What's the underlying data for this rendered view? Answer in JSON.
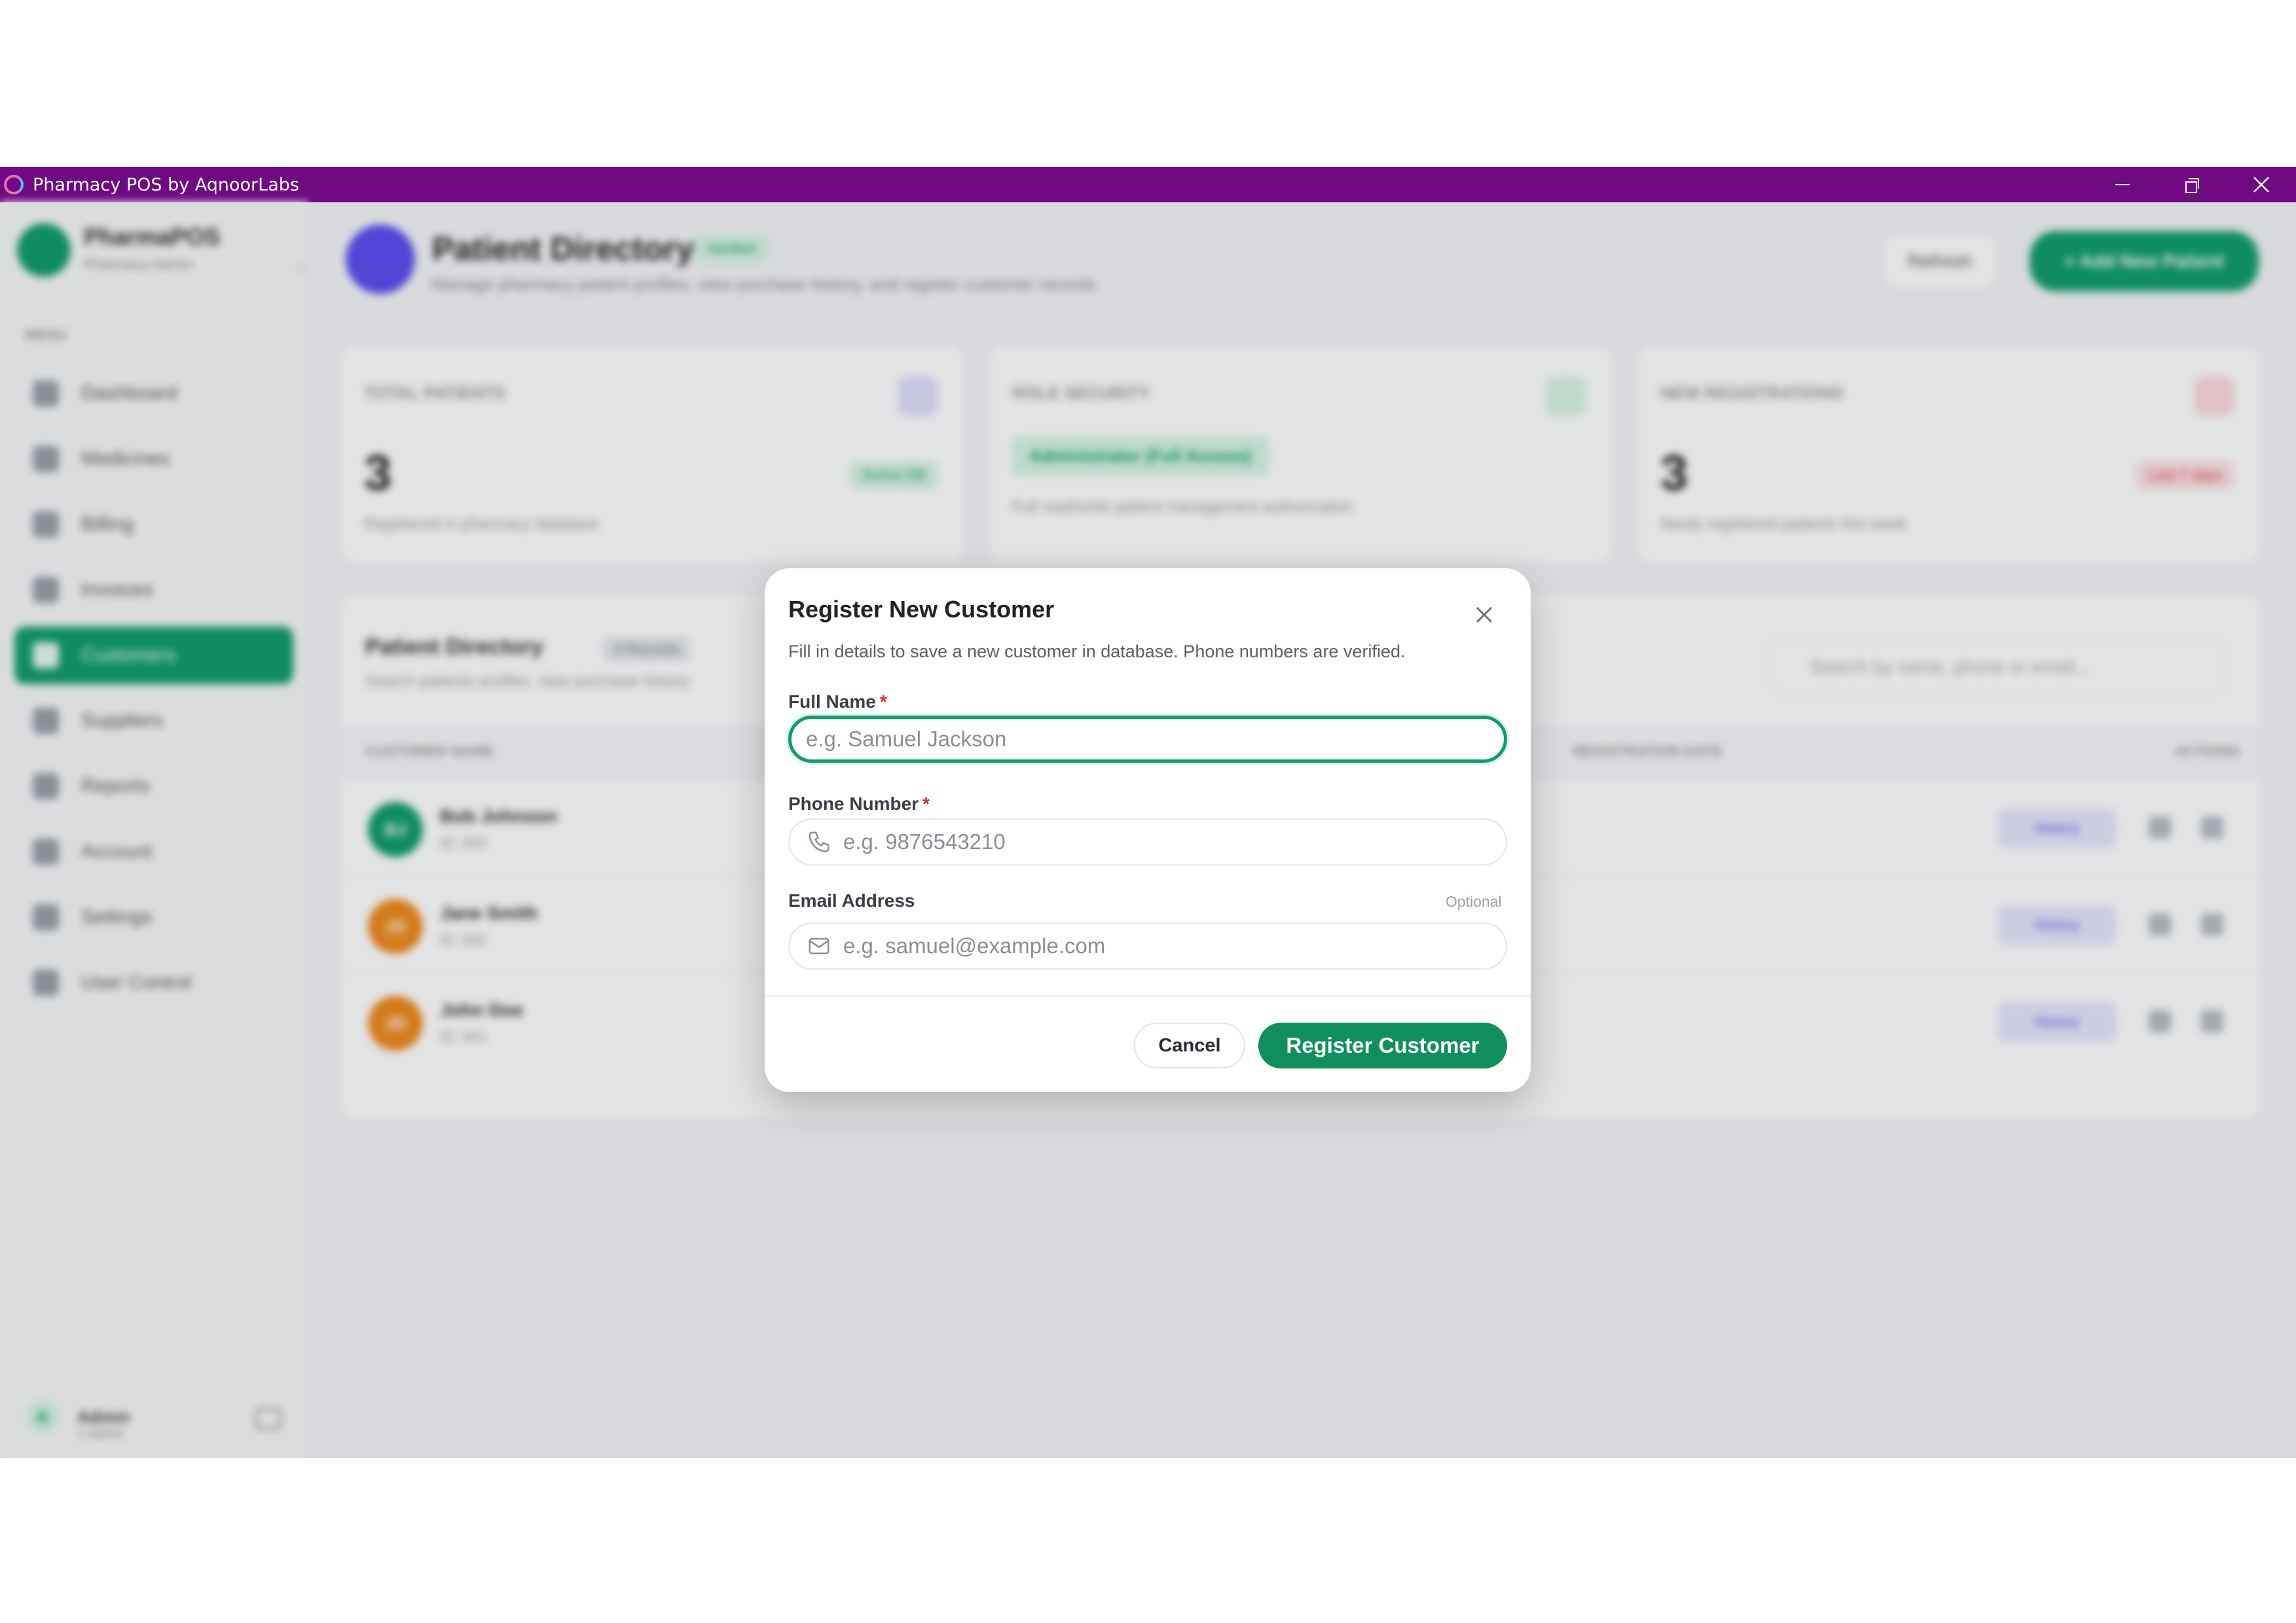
{
  "window": {
    "title": "Pharmacy POS by AqnoorLabs"
  },
  "sidebar": {
    "brand_name": "PharmaPOS",
    "brand_sub": "Pharmacy Admin",
    "menu_heading": "MENU",
    "items": [
      {
        "label": "Dashboard"
      },
      {
        "label": "Medicines"
      },
      {
        "label": "Billing"
      },
      {
        "label": "Invoices"
      },
      {
        "label": "Customers"
      },
      {
        "label": "Suppliers"
      },
      {
        "label": "Reports"
      },
      {
        "label": "Account"
      },
      {
        "label": "Settings"
      },
      {
        "label": "User Control"
      }
    ],
    "user": {
      "avatar": "A",
      "name": "Admin",
      "role": "1 Admin"
    }
  },
  "header": {
    "title": "Patient Directory",
    "badge": "Verified",
    "subtitle": "Manage pharmacy patient profiles, view purchase history, and register customer records",
    "refresh_label": "Refresh",
    "add_label": "+ Add New Patient"
  },
  "stats": [
    {
      "label": "TOTAL PATIENTS",
      "value": "3",
      "note": "Registered in pharmacy database",
      "chip": "Active DB"
    },
    {
      "label": "ROLE SECURITY",
      "admin": "Administrator (Full Access)",
      "note": "Full read/write patient management authorization"
    },
    {
      "label": "NEW REGISTRATIONS",
      "value": "3",
      "note": "Newly registered patients this week",
      "chip": "Last 7 days"
    }
  ],
  "table": {
    "title": "Patient Directory",
    "count": "3 Records",
    "subtitle": "Search patients profiles, view purchase history",
    "search_placeholder": "Search by name, phone or email...",
    "headers": {
      "name": "CUSTOMER NAME",
      "date": "REGISTRATION DATE",
      "actions": "ACTIONS"
    },
    "rows": [
      {
        "initials": "BJ",
        "name": "Bob Johnson",
        "id": "ID: 003",
        "color": "#0f9d6a"
      },
      {
        "initials": "JS",
        "name": "Jane Smith",
        "id": "ID: 002",
        "color": "#f08a1c"
      },
      {
        "initials": "JD",
        "name": "John Doe",
        "id": "ID: 001",
        "color": "#f08a1c"
      }
    ],
    "history_label": "History"
  },
  "modal": {
    "title": "Register New Customer",
    "description": "Fill in details to save a new customer in database. Phone numbers are verified.",
    "full_name": {
      "label": "Full Name",
      "required": "*",
      "placeholder": "e.g. Samuel Jackson",
      "value": ""
    },
    "phone": {
      "label": "Phone Number",
      "required": "*",
      "placeholder": "e.g. 9876543210",
      "value": "",
      "icon": "phone-icon"
    },
    "email": {
      "label": "Email Address",
      "optional": "Optional",
      "placeholder": "e.g. samuel@example.com",
      "value": "",
      "icon": "mail-icon"
    },
    "cancel_label": "Cancel",
    "submit_label": "Register Customer"
  },
  "colors": {
    "titlebar": "#6f0a82",
    "accent": "#0f9d6a",
    "required": "#e02a2a"
  }
}
